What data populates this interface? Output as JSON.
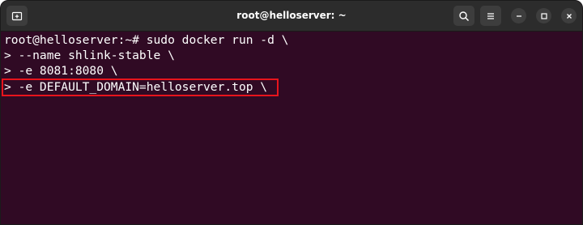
{
  "window": {
    "title": "root@helloserver: ~"
  },
  "icons": {
    "new_tab": "new-tab-icon",
    "search": "search-icon",
    "menu": "hamburger-menu-icon",
    "minimize": "minimize-icon",
    "maximize": "maximize-icon",
    "close": "close-icon"
  },
  "terminal": {
    "lines": [
      "root@helloserver:~# sudo docker run -d \\",
      "> --name shlink-stable \\",
      "> -e 8081:8080 \\",
      "> -e DEFAULT_DOMAIN=helloserver.top \\"
    ],
    "highlighted_line": 3
  },
  "colors": {
    "terminal_bg": "#300a24",
    "titlebar_bg": "#2c2c2c",
    "text": "#ffffff",
    "highlight": "#e8141c"
  }
}
